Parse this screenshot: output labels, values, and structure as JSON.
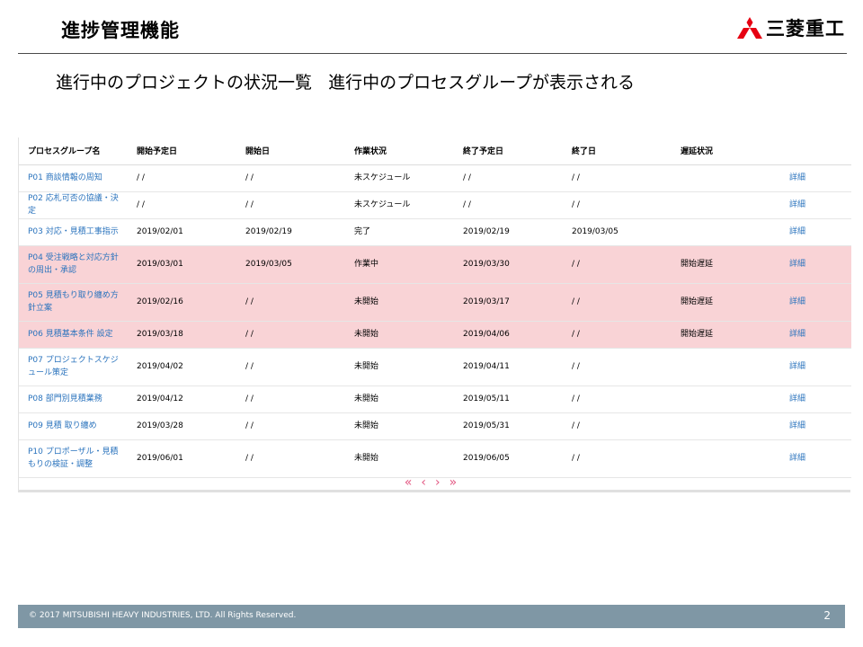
{
  "slide": {
    "title": "進捗管理機能",
    "logo_text": "三菱重工",
    "subtitle": "進行中のプロジェクトの状況一覧   進行中のプロセスグループが表示される"
  },
  "colors": {
    "delayed_row": "#f9d3d6",
    "link": "#2a73bd",
    "pager": "#e35a84",
    "footer": "#7f97a5",
    "logo": "#e60012"
  },
  "table": {
    "headers": [
      "プロセスグループ名",
      "開始予定日",
      "開始日",
      "作業状況",
      "終了予定日",
      "終了日",
      "遅延状況",
      ""
    ],
    "rows": [
      {
        "name": "P01 商談情報の周知",
        "plan_start": "/ /",
        "start": "/ /",
        "status": "未スケジュール",
        "plan_end": "/ /",
        "end": "/ /",
        "delay": "",
        "detail": "詳細",
        "delayed": false
      },
      {
        "name": "P02 応札可否の協議・決定",
        "plan_start": "/ /",
        "start": "/ /",
        "status": "未スケジュール",
        "plan_end": "/ /",
        "end": "/ /",
        "delay": "",
        "detail": "詳細",
        "delayed": false
      },
      {
        "name": "P03 対応・見積工事指示",
        "plan_start": "2019/02/01",
        "start": "2019/02/19",
        "status": "完了",
        "plan_end": "2019/02/19",
        "end": "2019/03/05",
        "delay": "",
        "detail": "詳細",
        "delayed": false
      },
      {
        "name": "P04 受注戦略と対応方針の周出・承認",
        "plan_start": "2019/03/01",
        "start": "2019/03/05",
        "status": "作業中",
        "plan_end": "2019/03/30",
        "end": "/ /",
        "delay": "開始遅延",
        "detail": "詳細",
        "delayed": true
      },
      {
        "name": "P05 見積もり取り纏め方針立案",
        "plan_start": "2019/02/16",
        "start": "/ /",
        "status": "未開始",
        "plan_end": "2019/03/17",
        "end": "/ /",
        "delay": "開始遅延",
        "detail": "詳細",
        "delayed": true
      },
      {
        "name": "P06 見積基本条件 設定",
        "plan_start": "2019/03/18",
        "start": "/ /",
        "status": "未開始",
        "plan_end": "2019/04/06",
        "end": "/ /",
        "delay": "開始遅延",
        "detail": "詳細",
        "delayed": true
      },
      {
        "name": "P07 プロジェクトスケジュール策定",
        "plan_start": "2019/04/02",
        "start": "/ /",
        "status": "未開始",
        "plan_end": "2019/04/11",
        "end": "/ /",
        "delay": "",
        "detail": "詳細",
        "delayed": false
      },
      {
        "name": "P08 部門別見積業務",
        "plan_start": "2019/04/12",
        "start": "/ /",
        "status": "未開始",
        "plan_end": "2019/05/11",
        "end": "/ /",
        "delay": "",
        "detail": "詳細",
        "delayed": false
      },
      {
        "name": "P09 見積 取り纏め",
        "plan_start": "2019/03/28",
        "start": "/ /",
        "status": "未開始",
        "plan_end": "2019/05/31",
        "end": "/ /",
        "delay": "",
        "detail": "詳細",
        "delayed": false
      },
      {
        "name": "P10 プロポーザル・見積もりの検証・調整",
        "plan_start": "2019/06/01",
        "start": "/ /",
        "status": "未開始",
        "plan_end": "2019/06/05",
        "end": "/ /",
        "delay": "",
        "detail": "詳細",
        "delayed": false
      }
    ]
  },
  "pager": {
    "first": "«",
    "prev": "‹",
    "next": "›",
    "last": "»"
  },
  "footer": {
    "copyright": "© 2017 MITSUBISHI HEAVY INDUSTRIES, LTD.  All Rights Reserved.",
    "page_number": "2"
  }
}
